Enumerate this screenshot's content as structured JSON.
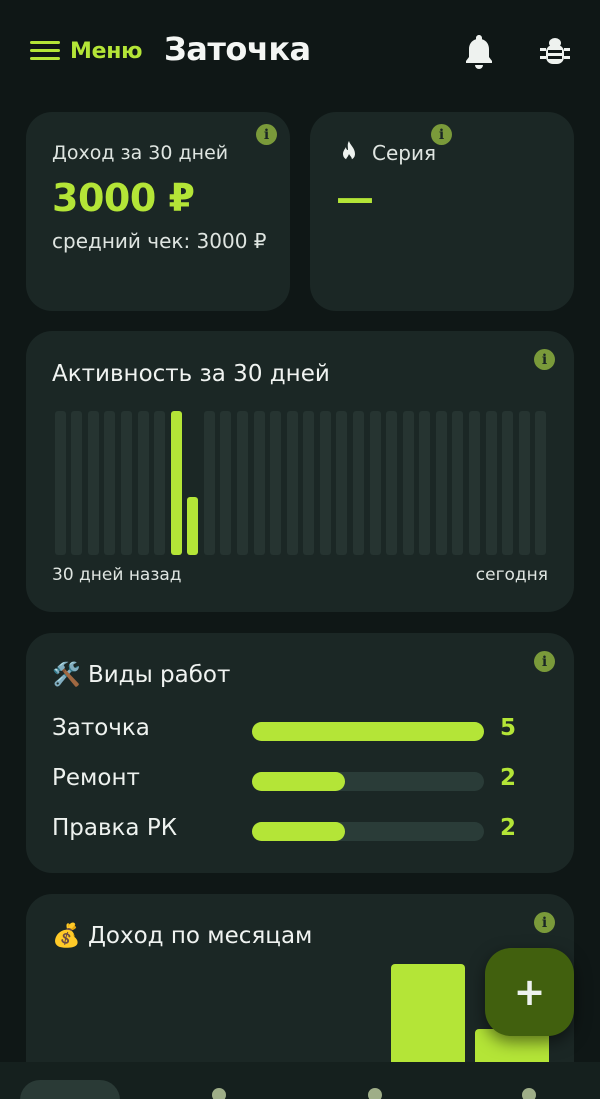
{
  "header": {
    "menu_label": "Меню",
    "title": "Заточка"
  },
  "income": {
    "label": "Доход за 30 дней",
    "value": "3000 ₽",
    "avg": "средний чек: 3000 ₽"
  },
  "streak": {
    "label": "Серия",
    "value": "—"
  },
  "activity": {
    "title": "Активность за 30 дней",
    "start_label": "30 дней назад",
    "end_label": "сегодня",
    "counts": [
      0,
      0,
      0,
      0,
      0,
      0,
      0,
      5,
      2,
      0,
      0,
      0,
      0,
      0,
      0,
      0,
      0,
      0,
      0,
      0,
      0,
      0,
      0,
      0,
      0,
      0,
      0,
      0,
      0,
      0
    ]
  },
  "work": {
    "title": "🛠️ Виды работ",
    "items": [
      {
        "name": "Заточка",
        "count": "5",
        "value": 5
      },
      {
        "name": "Ремонт",
        "count": "2",
        "value": 2
      },
      {
        "name": "Правка РК",
        "count": "2",
        "value": 2
      }
    ],
    "max": 5
  },
  "monthly": {
    "title": "💰 Доход по месяцам",
    "values": [
      3000,
      1000
    ]
  },
  "fab_label": "+",
  "info_glyph": "i",
  "colors": {
    "accent": "#b4e537",
    "card": "#1b2725",
    "background": "#0f1716"
  }
}
